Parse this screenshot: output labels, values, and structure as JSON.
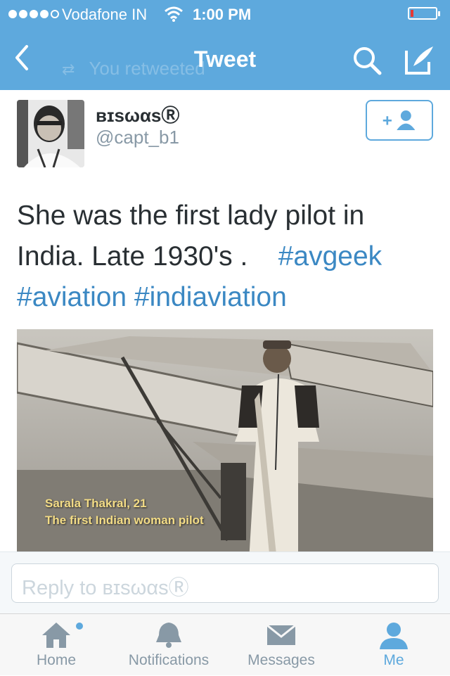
{
  "status_bar": {
    "carrier": "Vodafone IN",
    "time": "1:00 PM",
    "signal_bars_filled": 4,
    "signal_bars_total": 5,
    "battery_level": 0.1
  },
  "nav": {
    "title": "Tweet",
    "retweet_ghost": "You retweeted"
  },
  "tweet": {
    "display_name": "ʙɪsωαsⓇ",
    "handle": "@capt_b1",
    "text_plain": "She was the first lady pilot in India. Late 1930's .",
    "hashtags": [
      "#avgeek",
      "#aviation",
      "#indiaviation"
    ],
    "photo_caption_line1": "Sarala Thakral, 21",
    "photo_caption_line2": "The first Indian woman pilot"
  },
  "reply": {
    "placeholder": "Reply to ʙɪsωαsⓇ"
  },
  "tabs": [
    {
      "label": "Home",
      "icon": "home-icon",
      "has_dot": true
    },
    {
      "label": "Notifications",
      "icon": "bell-icon"
    },
    {
      "label": "Messages",
      "icon": "envelope-icon"
    },
    {
      "label": "Me",
      "icon": "person-icon",
      "active": true
    }
  ],
  "colors": {
    "brand": "#5ea9dd",
    "hashtag": "#3b88c3",
    "text": "#292f33",
    "muted": "#8899a6",
    "battery_low": "#e53935"
  }
}
